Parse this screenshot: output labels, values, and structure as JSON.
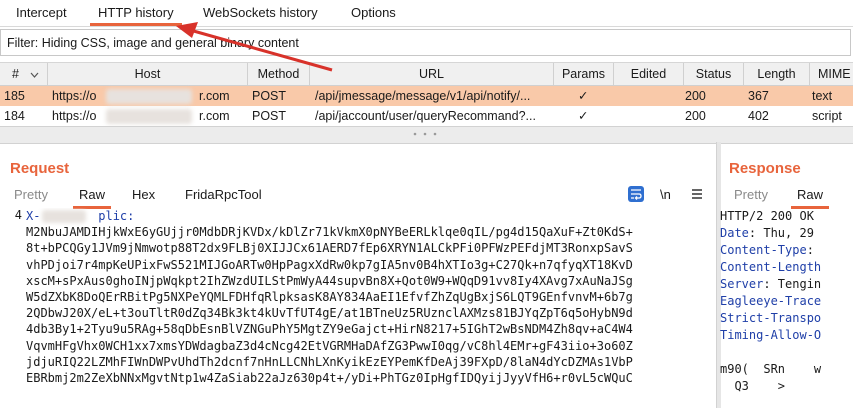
{
  "top_tabs": [
    "Intercept",
    "HTTP history",
    "WebSockets history",
    "Options"
  ],
  "filter_text": "Filter: Hiding CSS, image and general binary content",
  "columns": [
    "#",
    "Host",
    "Method",
    "URL",
    "Params",
    "Edited",
    "Status",
    "Length",
    "MIME"
  ],
  "rows": [
    {
      "num": "185",
      "host_prefix": "https://o",
      "host_suffix": "r.com",
      "method": "POST",
      "url": "/api/jmessage/message/v1/api/notify/...",
      "params": "✓",
      "edited": "",
      "status": "200",
      "length": "367",
      "mime": "text"
    },
    {
      "num": "184",
      "host_prefix": "https://o",
      "host_suffix": "r.com",
      "method": "POST",
      "url": "/api/jaccount/user/queryRecommand?...",
      "params": "✓",
      "edited": "",
      "status": "200",
      "length": "402",
      "mime": "script"
    }
  ],
  "request": {
    "title": "Request",
    "tabs": [
      "Pretty",
      "Raw",
      "Hex",
      "FridaRpcTool"
    ],
    "line_number": "4",
    "lines": [
      "X-        plic:",
      "M2NbuJAMDIHjkWxE6yGUjjr0MdbDRjKVDx/kDlZr71kVkmX0pNYBeERLklqe0qIL/pg4d15QaXuF+Zt0KdS+",
      "8t+bPCQGy1JVm9jNmwotp88T2dx9FLBj0XIJJCx61AERD7fEp6XRYN1ALCkPFi0PFWzPEFdjMT3RonxpSavS",
      "vhPDjoi7r4mpKeUPixFwS521MIJGoARTw0HpPagxXdRw0kp7gIA5nv0B4hXTIo3g+C27Qk+n7qfyqXT18KvD",
      "xscM+sPxAus0ghoINjpWqkpt2IhZWzdUILStPmWyA44supvBn8X+Qot0W9+WQqD91vv8Iy4XAvg7xAuNaJSg",
      "W5dZXbK8DoQErRBitPg5NXPeYQMLFDHfqRlpksasK8AY834AaEI1EfvfZhZqUgBxjS6LQT9GEnfvnvM+6b7g",
      "2QDbwJ20X/eL+t3ouTltR0dZq34Bk3kt4kUvTfUT4gE/at1BTneUz5RUznclAXMzs81BJYqZpT6q5oHybN9d",
      "4db3By1+2Tyu9u5RAg+58qDbEsnBlVZNGuPhY5MgtZY9eGajct+HirN8217+5IGhT2wBsNDM4Zh8qv+aC4W4",
      "VqvmHFgVhx0WCH1xx7xmsYDWdagbaZ3d4cNcg42EtVGRMHaDAfZG3PwwI0qg/vC8hl4EMr+gF43iio+3o60Z",
      "jdjuRIQ22LZMhFIWnDWPvUhdTh2dcnf7nHnLLCNhLXnKyikEzEYPemKfDeAj39FXpD/8laN4dYcDZMAs1VbP",
      "EBRbmj2m2ZeXbNNxMgvtNtp1w4ZaSiab22aJz630p4t+/yDi+PhTGz0IpHgfIDQyijJyyVfH6+r0vL5cWQuC"
    ]
  },
  "response": {
    "title": "Response",
    "tabs": [
      "Pretty",
      "Raw"
    ],
    "lines": [
      {
        "key": "",
        "rest": "HTTP/2 200 OK"
      },
      {
        "key": "Date",
        "rest": ": Thu, 29"
      },
      {
        "key": "Content-Type",
        "rest": ":"
      },
      {
        "key": "Content-Length",
        "rest": ""
      },
      {
        "key": "Server",
        "rest": ": Tengin"
      },
      {
        "key": "Eagleeye-Trace",
        "rest": ""
      },
      {
        "key": "Strict-Transpo",
        "rest": ""
      },
      {
        "key": "Timing-Allow-O",
        "rest": ""
      },
      {
        "key": "",
        "rest": ""
      },
      {
        "key": "",
        "rest": "m90(  SRn    w"
      },
      {
        "key": "",
        "rest": "  Q3    >"
      }
    ]
  },
  "icons": {
    "wrap": "wrap-lines-icon",
    "newline": "newline-icon",
    "menu": "hamburger-menu-icon"
  },
  "newline_label": "\\n",
  "colors": {
    "accent": "#e8643c",
    "selected_row": "#f9c9a9",
    "header_key": "#1f3fa8",
    "arrow": "#d8322a"
  }
}
